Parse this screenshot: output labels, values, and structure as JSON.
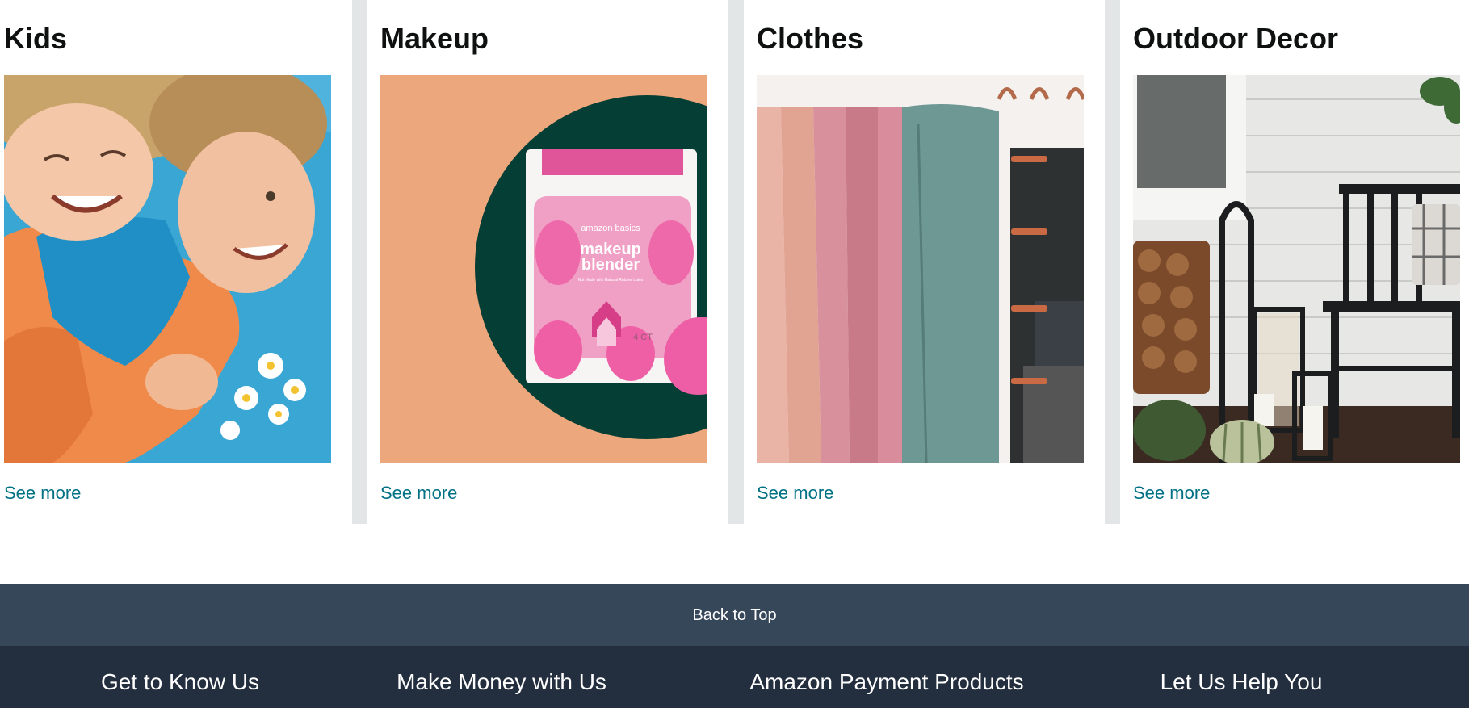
{
  "cards": [
    {
      "title": "Kids",
      "link": "See more",
      "image": "kids-hugging-photo"
    },
    {
      "title": "Makeup",
      "link": "See more",
      "image": "makeup-blender-package-photo"
    },
    {
      "title": "Clothes",
      "link": "See more",
      "image": "hanging-blankets-photo"
    },
    {
      "title": "Outdoor Decor",
      "link": "See more",
      "image": "porch-decor-photo"
    }
  ],
  "product_package": {
    "brand": "amazon basics",
    "name_line1": "makeup",
    "name_line2": "blender",
    "subtitle": "Not Made with Natural Rubber Latex",
    "count": "4 CT"
  },
  "back_to_top": "Back to Top",
  "footer": {
    "columns": [
      "Get to Know Us",
      "Make Money with Us",
      "Amazon Payment Products",
      "Let Us Help You"
    ]
  },
  "colors": {
    "link": "#007185",
    "back_to_top_bg": "#37475a",
    "footer_bg": "#232f3e",
    "gap_bg": "#e3e6e6"
  }
}
